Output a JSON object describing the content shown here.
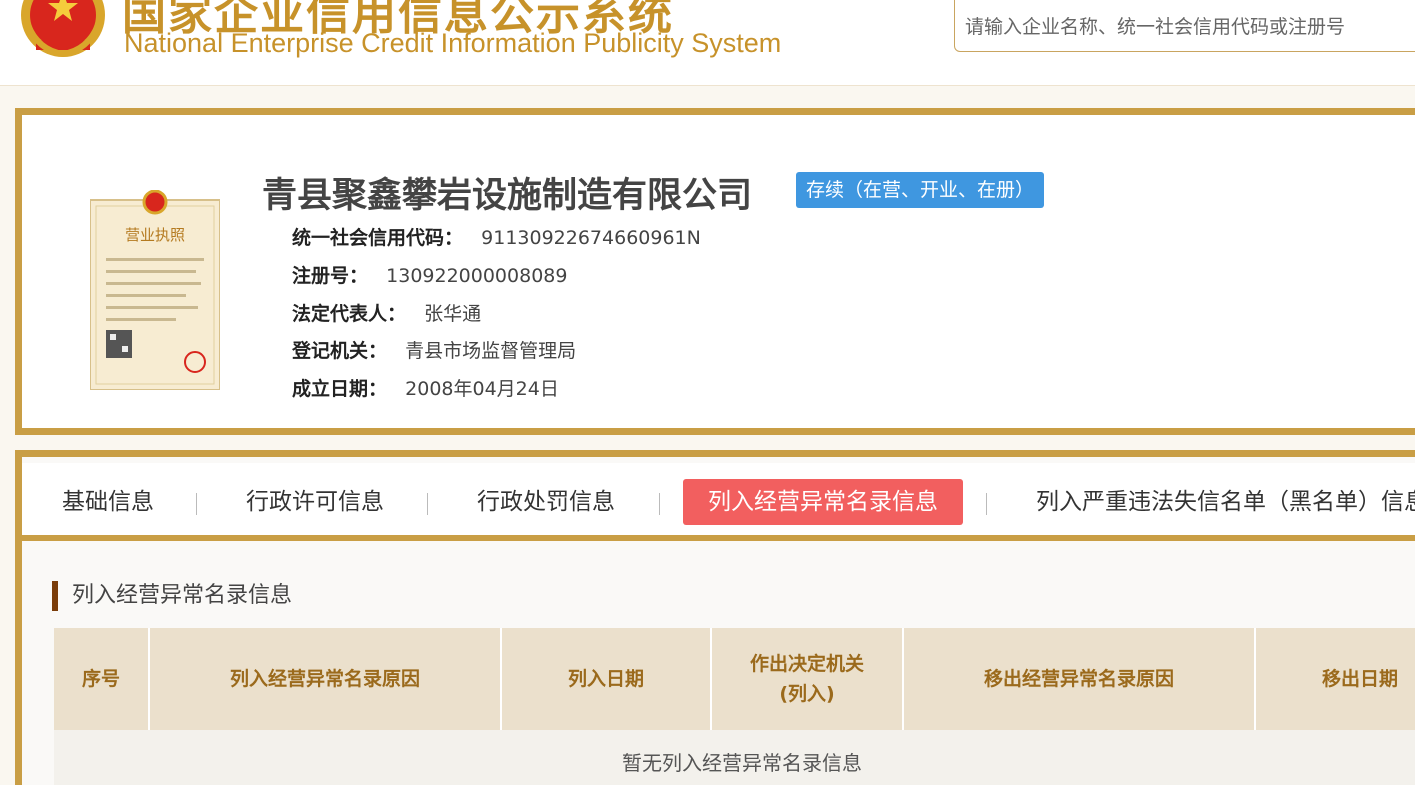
{
  "header": {
    "title_cn": "国家企业信用信息公示系统",
    "title_en": "National Enterprise Credit Information Publicity System",
    "search_placeholder": "请输入企业名称、统一社会信用代码或注册号"
  },
  "company": {
    "name": "青县聚鑫攀岩设施制造有限公司",
    "status": "存续（在营、开业、在册）",
    "license_title": "营业执照",
    "fields": [
      {
        "label": "统一社会信用代码：",
        "value": "91130922674660961N"
      },
      {
        "label": "注册号：",
        "value": "130922000008089"
      },
      {
        "label": "法定代表人：",
        "value": "张华通"
      },
      {
        "label": "登记机关：",
        "value": "青县市场监督管理局"
      },
      {
        "label": "成立日期：",
        "value": "2008年04月24日"
      }
    ]
  },
  "tabs": [
    {
      "label": "基础信息",
      "active": false
    },
    {
      "label": "行政许可信息",
      "active": false
    },
    {
      "label": "行政处罚信息",
      "active": false
    },
    {
      "label": "列入经营异常名录信息",
      "active": true
    },
    {
      "label": "列入严重违法失信名单（黑名单）信息",
      "active": false
    }
  ],
  "section": {
    "title": "列入经营异常名录信息",
    "columns": [
      "序号",
      "列入经营异常名录原因",
      "列入日期",
      "作出决定机关",
      "(列入)",
      "移出经营异常名录原因",
      "移出日期"
    ],
    "empty_text": "暂无列入经营异常名录信息"
  },
  "colors": {
    "gold": "#c99e45",
    "title_gold": "#c7922a",
    "badge_blue": "#3f97e0",
    "active_tab": "#f25f5f"
  }
}
